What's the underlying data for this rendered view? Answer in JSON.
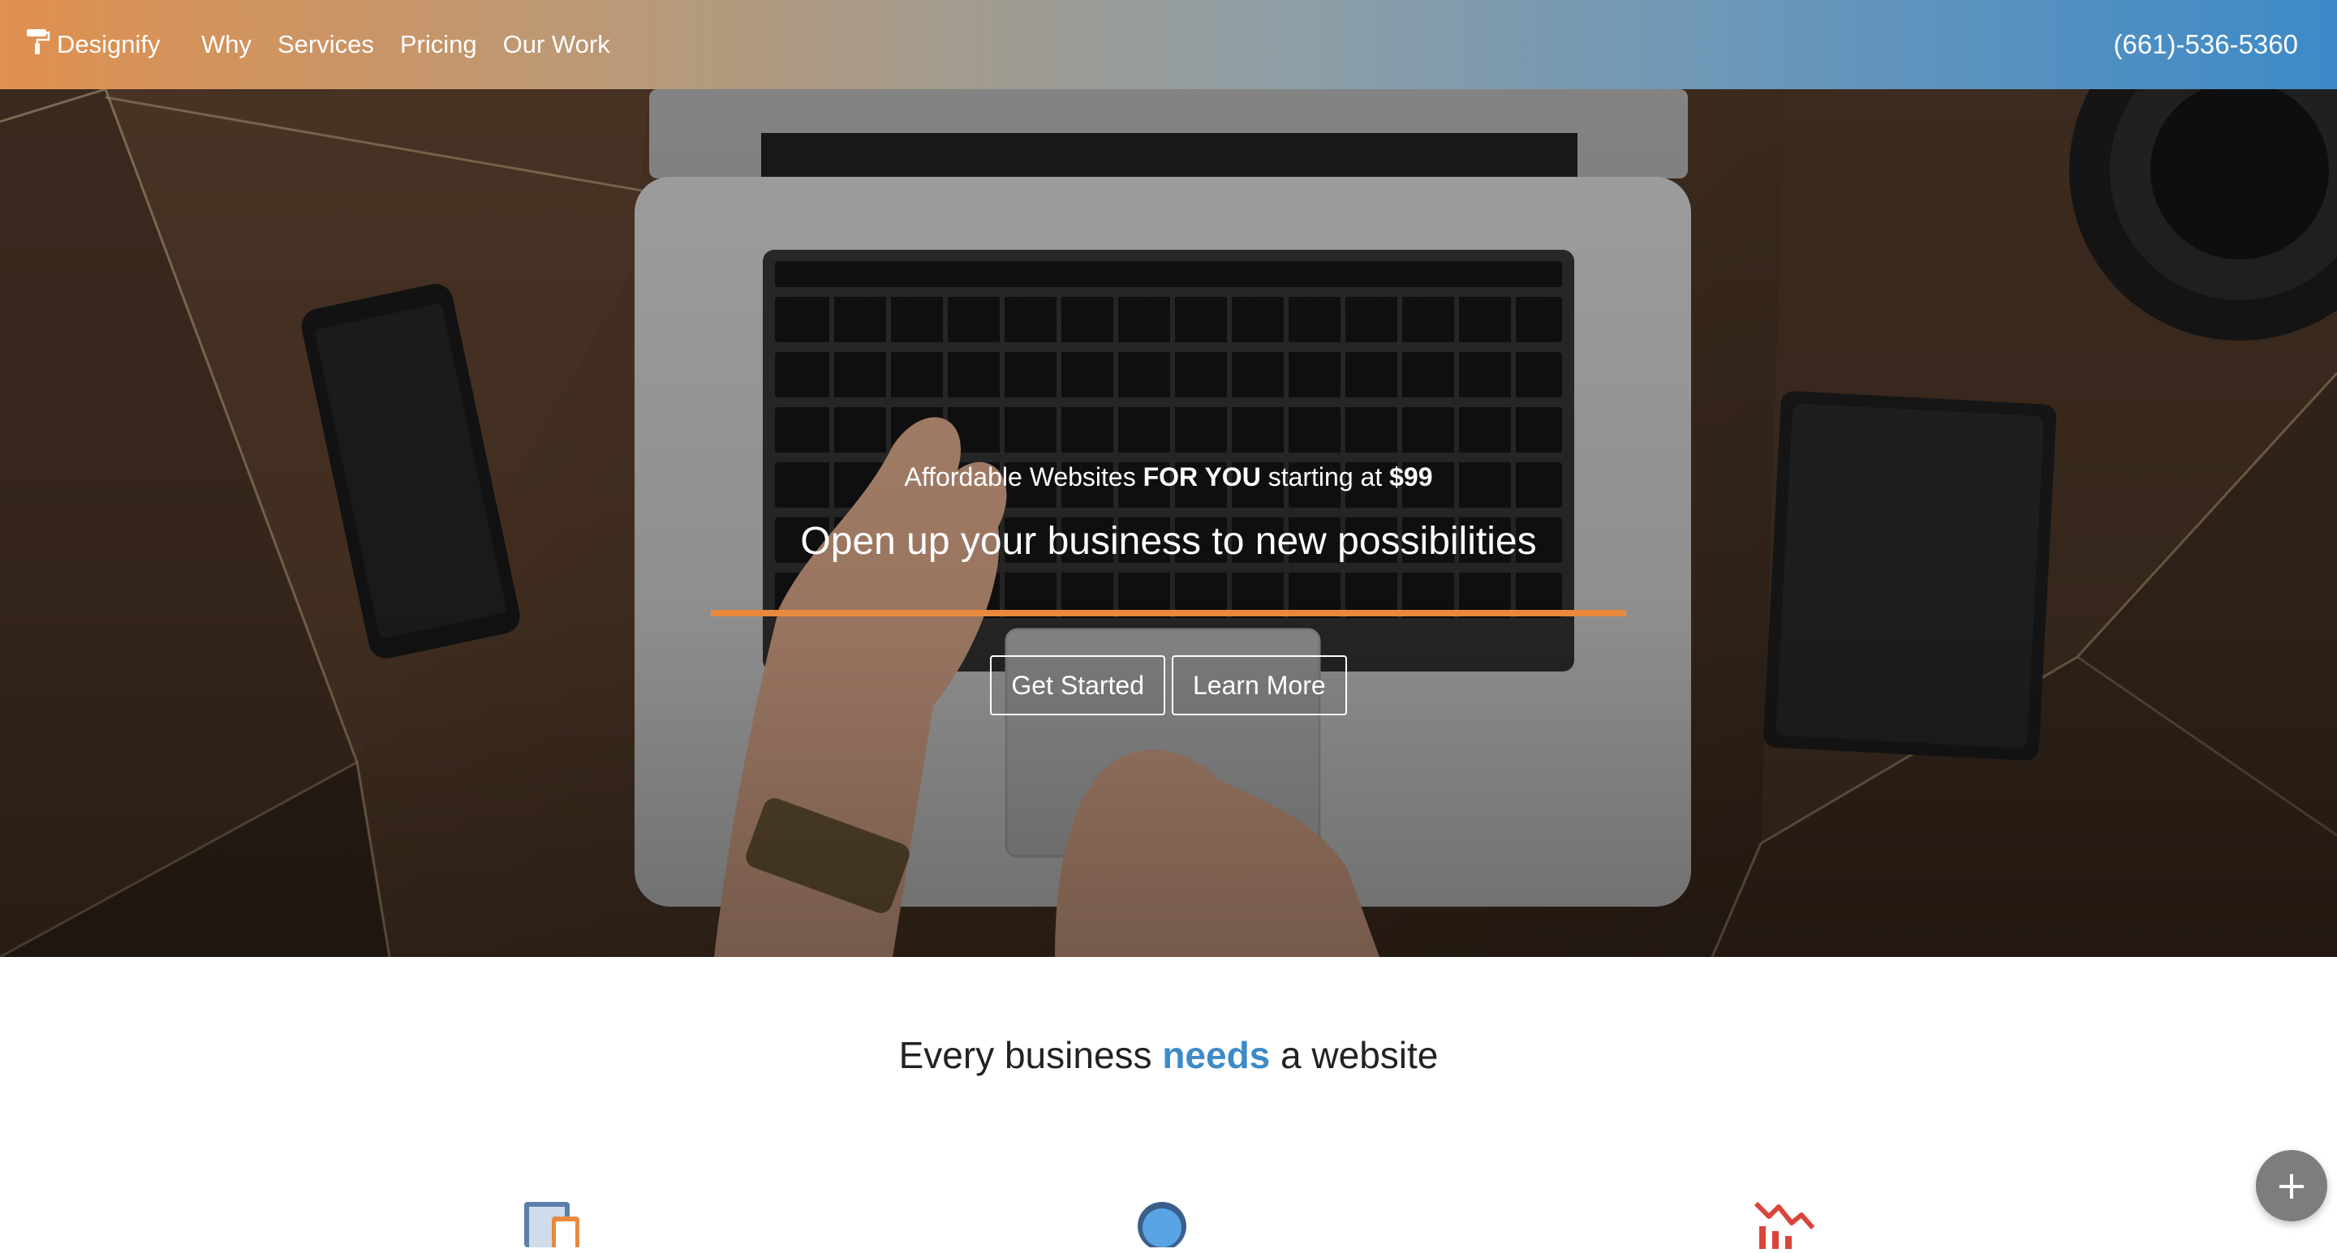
{
  "navbar": {
    "brand_icon": "paint-roller-icon",
    "brand_name": "Designify",
    "links": [
      "Why",
      "Services",
      "Pricing",
      "Our Work"
    ],
    "phone": "(661)-536-5360",
    "gradient_start": "#e0904f",
    "gradient_end": "#3d8ac8"
  },
  "hero": {
    "tagline_prefix": "Affordable Websites ",
    "tagline_bold": "FOR YOU",
    "tagline_middle": " starting at ",
    "tagline_price": "$99",
    "title": "Open up your business to new possibilities",
    "accent_rule_color": "#e8893e",
    "buttons": {
      "get_started": "Get Started",
      "learn_more": "Learn More"
    }
  },
  "section": {
    "heading_prefix": "Every business ",
    "heading_accent": "needs",
    "heading_suffix": " a website",
    "accent_color": "#3d8ac8",
    "feature_icons": [
      "devices-icon",
      "globe-icon",
      "chart-decline-icon"
    ]
  },
  "fab": {
    "icon": "plus-icon",
    "label": "+"
  }
}
